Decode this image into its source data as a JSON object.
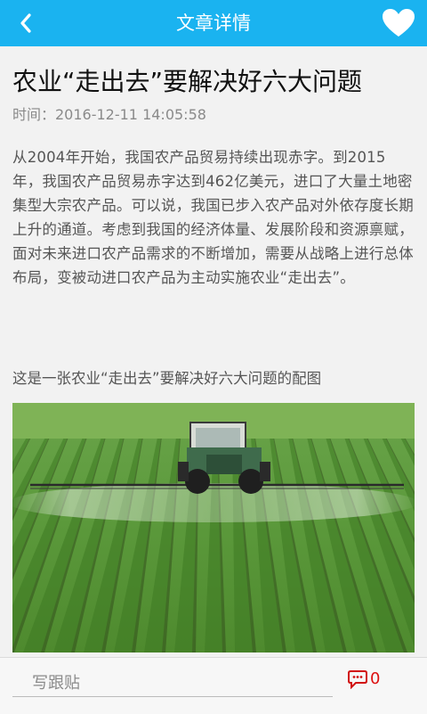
{
  "header": {
    "title": "文章详情",
    "accent_color": "#1ab3f0",
    "back_icon": "chevron-left-icon",
    "favorite_icon": "heart-icon"
  },
  "article": {
    "title": "农业“走出去”要解决好六大问题",
    "time": "时间：2016-12-11 14:05:58",
    "body": "从2004年开始，我国农产品贸易持续出现赤字。到2015年，我国农产品贸易赤字达到462亿美元，进口了大量土地密集型大宗农产品。可以说，我国已步入农产品对外依存度长期上升的通道。考虑到我国的经济体量、发展阶段和资源禀赋，面对未来进口农产品需求的不断增加，需要从战略上进行总体布局，变被动进口农产品为主动实施农业“走出去”。",
    "caption": "这是一张农业“走出去”要解决好六大问题的配图",
    "image_description": "tractor-spraying-crop-field"
  },
  "footer": {
    "reply_placeholder": "写跟贴",
    "comment_icon": "comment-bubble-icon",
    "comment_count": "0",
    "comment_color": "#d11111"
  }
}
